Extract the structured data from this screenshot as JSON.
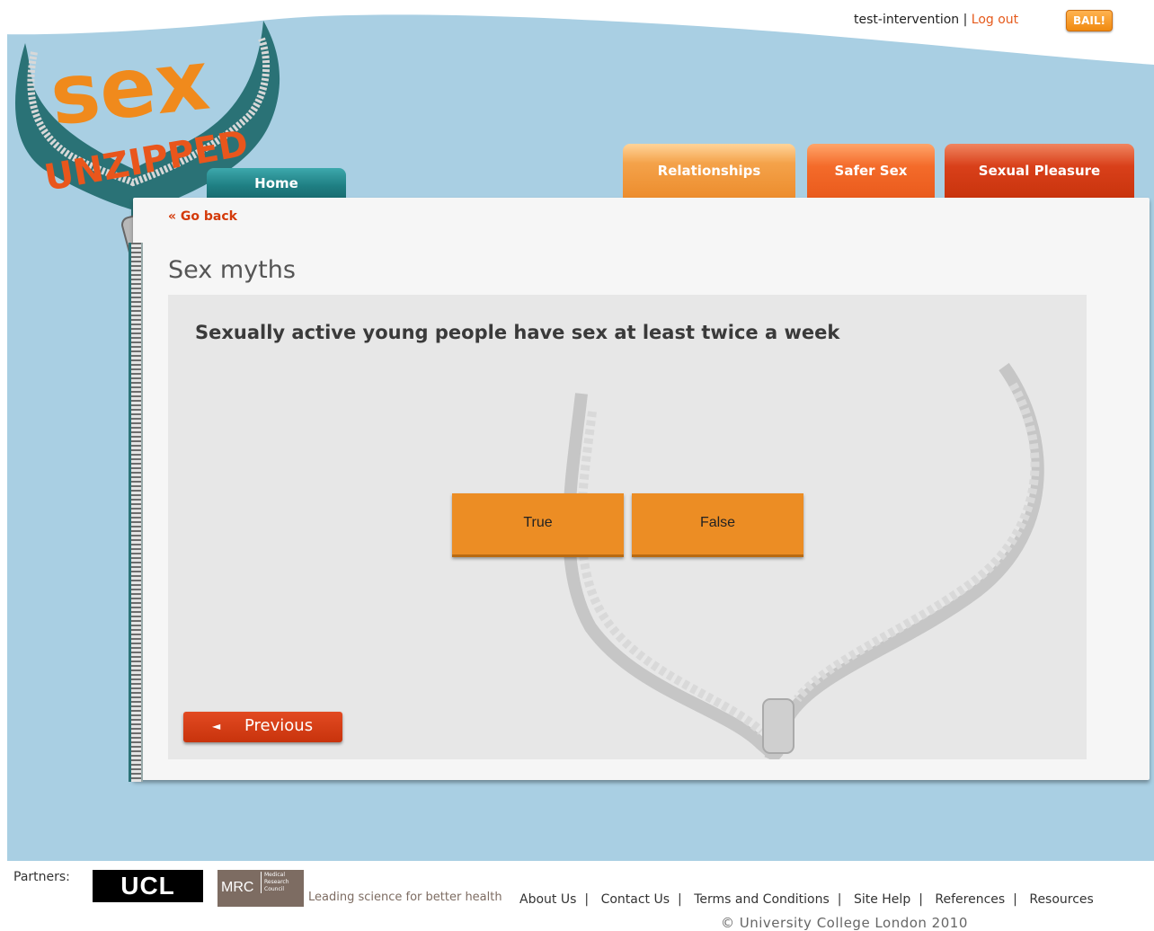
{
  "header": {
    "username": "test-intervention",
    "separator": "|",
    "logout_label": "Log out",
    "bail_label": "BAIL!"
  },
  "logo": {
    "line1": "sex",
    "line2": "UNZIPPED"
  },
  "tabs": [
    {
      "label": "Home"
    },
    {
      "label": "Relationships"
    },
    {
      "label": "Safer Sex"
    },
    {
      "label": "Sexual Pleasure"
    }
  ],
  "content": {
    "go_back_label": "« Go back",
    "page_title": "Sex myths",
    "question": "Sexually active young people have sex at least twice a week",
    "true_label": "True",
    "false_label": "False",
    "previous_label": "Previous",
    "previous_arrow": "◄"
  },
  "footer": {
    "partners_label": "Partners:",
    "ucl_label": "UCL",
    "mrc_label": "MRC",
    "mrc_small": [
      "Medical",
      "Research",
      "Council"
    ],
    "mrc_tagline": "Leading science for better health",
    "links": [
      "About Us",
      "Contact Us",
      "Terms and Conditions",
      "Site Help",
      "References",
      "Resources"
    ],
    "copyright": "© University College London 2010"
  },
  "colors": {
    "sky": "#a9cfe3",
    "home_tab": "#1f7f83",
    "relationships_tab": "#ec8c2c",
    "safer_sex_tab": "#e95a1c",
    "sexual_pleasure_tab": "#c8330c",
    "answer_button": "#ec8d24",
    "previous_button": "#c8330c",
    "link_accent": "#d43a0a"
  }
}
